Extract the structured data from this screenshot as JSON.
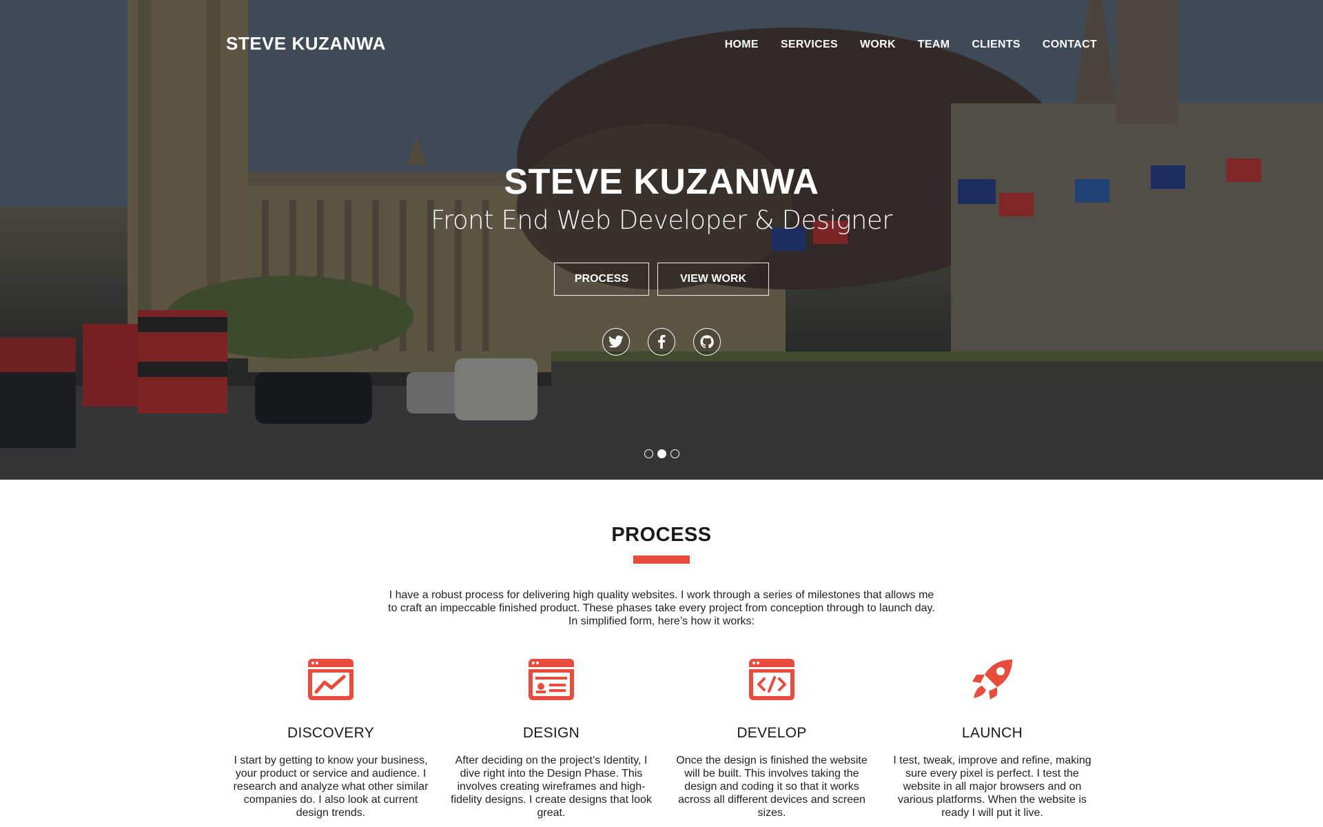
{
  "header": {
    "brand": "STEVE KUZANWA",
    "nav": [
      "HOME",
      "SERVICES",
      "WORK",
      "TEAM",
      "CLIENTS",
      "CONTACT"
    ]
  },
  "hero": {
    "title": "STEVE KUZANWA",
    "subtitle": "Front End Web Developer & Designer",
    "buttons": {
      "process": "PROCESS",
      "view_work": "VIEW WORK"
    },
    "social_icons": [
      "twitter-icon",
      "facebook-icon",
      "github-icon"
    ],
    "slider": {
      "slide_count": 3,
      "active_index": 1
    }
  },
  "process": {
    "title": "PROCESS",
    "intro_lines": [
      "I have a robust process for delivering high quality websites. I work through a series of milestones that allows me",
      "to craft an impeccable finished product. These phases take every project from conception through to launch day.",
      "In simplified form, here’s how it works:"
    ],
    "steps": [
      {
        "icon": "analytics-window-icon",
        "title": "DISCOVERY",
        "text": "I start by getting to know your business, your product or service and audience. I research and analyze what other similar companies do. I also look at current design trends."
      },
      {
        "icon": "design-window-icon",
        "title": "DESIGN",
        "text": "After deciding on the project’s Identity, I dive right into the Design Phase. This involves creating wireframes and high-fidelity designs. I create designs that look great."
      },
      {
        "icon": "code-window-icon",
        "title": "DEVELOP",
        "text": "Once the design is finished the website will be built. This involves taking the design and coding it so that it works across all different devices and screen sizes."
      },
      {
        "icon": "rocket-icon",
        "title": "LAUNCH",
        "text": "I test, tweak, improve and refine, making sure every pixel is perfect. I test the website in all major browsers and on various platforms. When the website is ready I will put it live."
      }
    ]
  },
  "colors": {
    "accent": "#e74c3c",
    "text": "#222222",
    "white": "#ffffff"
  }
}
